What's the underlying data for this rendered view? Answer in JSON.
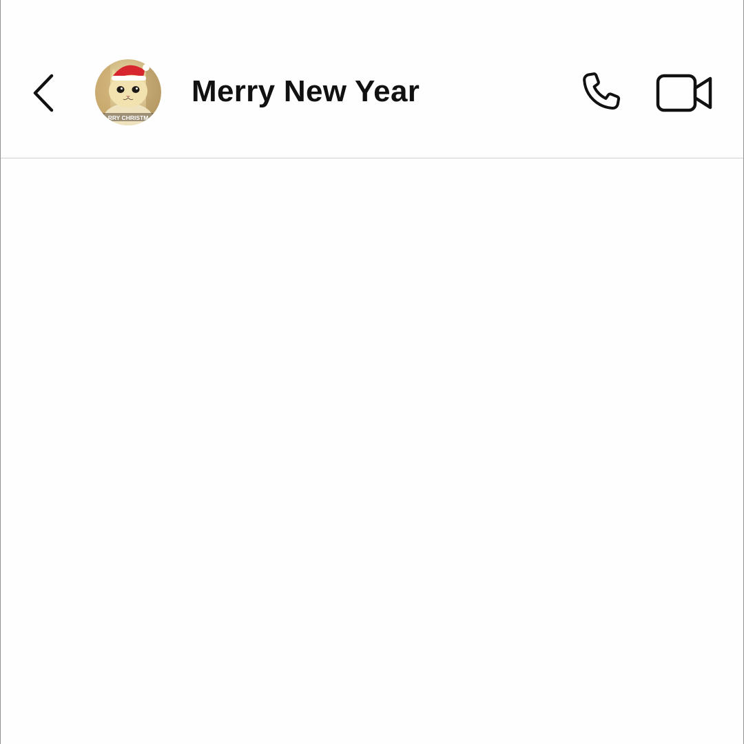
{
  "header": {
    "title": "Merry New Year",
    "back_icon": "chevron-left-icon",
    "avatar": {
      "description_icon": "cat-with-santa-hat-avatar",
      "overlay_text": "RRY CHRISTM"
    },
    "actions": [
      {
        "icon": "phone-icon"
      },
      {
        "icon": "video-camera-icon"
      }
    ]
  },
  "colors": {
    "text": "#111111",
    "background": "#fefefe",
    "divider": "#cfcfcf",
    "santa_hat_red": "#d8262e",
    "cat_fur": "#e9d6a0"
  },
  "conversation": {
    "messages": []
  }
}
